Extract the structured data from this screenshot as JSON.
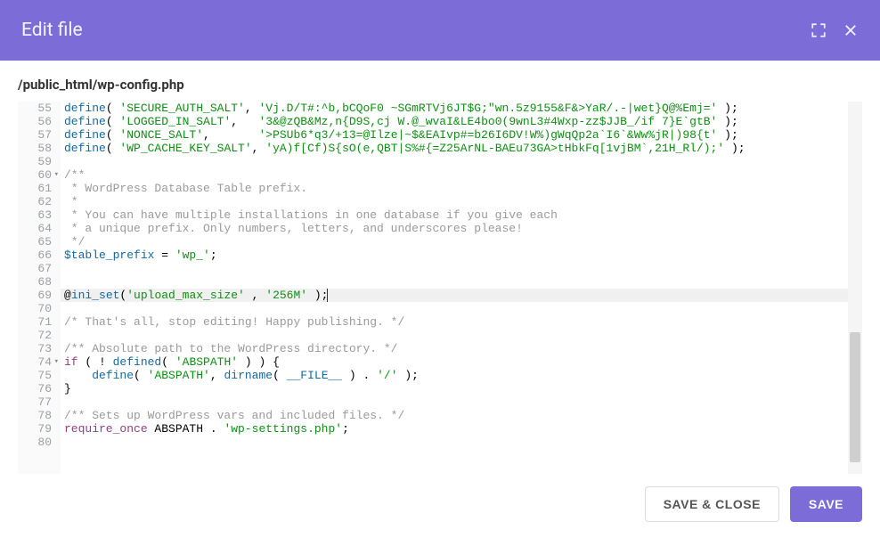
{
  "header": {
    "title": "Edit file"
  },
  "path": "/public_html/wp-config.php",
  "buttons": {
    "save_close": "SAVE & CLOSE",
    "save": "SAVE"
  },
  "editor": {
    "highlighted_line": 69,
    "fold_lines": [
      60,
      74
    ],
    "lines": [
      {
        "n": 55,
        "tokens": [
          [
            "fn",
            "define"
          ],
          [
            "p",
            "( "
          ],
          [
            "str",
            "'SECURE_AUTH_SALT'"
          ],
          [
            "p",
            ", "
          ],
          [
            "str",
            "'Vj.D/T#:^b,bCQoF0 ~SGmRTVj6JT$G;\"wn.5z9155&F&>YaR/.-|wet}Q@%Emj='"
          ],
          [
            "p",
            " );"
          ]
        ]
      },
      {
        "n": 56,
        "tokens": [
          [
            "fn",
            "define"
          ],
          [
            "p",
            "( "
          ],
          [
            "str",
            "'LOGGED_IN_SALT'"
          ],
          [
            "p",
            ",   "
          ],
          [
            "str",
            "'3&@zQB&Mz,n{D9S,cj W.@_wvaI&LE4bo0(9wnL3#4Wxp-zz$JJB_/if 7}E`gtB'"
          ],
          [
            "p",
            " );"
          ]
        ]
      },
      {
        "n": 57,
        "tokens": [
          [
            "fn",
            "define"
          ],
          [
            "p",
            "( "
          ],
          [
            "str",
            "'NONCE_SALT'"
          ],
          [
            "p",
            ",       "
          ],
          [
            "str",
            "'>PSUb6*q3/+13=@Ilze|~$&EAIvp#=b26I6DV!W%)gWqQp2a`I6`&Ww%jR|)98{t'"
          ],
          [
            "p",
            " );"
          ]
        ]
      },
      {
        "n": 58,
        "tokens": [
          [
            "fn",
            "define"
          ],
          [
            "p",
            "( "
          ],
          [
            "str",
            "'WP_CACHE_KEY_SALT'"
          ],
          [
            "p",
            ", "
          ],
          [
            "str",
            "'yA)f[Cf)S{sO(e,QBT|S%#{=Z25ArNL-BAEu73GA>tHbkFq[1vjBM`,21H_Rl/);'"
          ],
          [
            "p",
            " );"
          ]
        ]
      },
      {
        "n": 59,
        "tokens": []
      },
      {
        "n": 60,
        "tokens": [
          [
            "cmt",
            "/**"
          ]
        ]
      },
      {
        "n": 61,
        "tokens": [
          [
            "cmt",
            " * WordPress Database Table prefix."
          ]
        ]
      },
      {
        "n": 62,
        "tokens": [
          [
            "cmt",
            " *"
          ]
        ]
      },
      {
        "n": 63,
        "tokens": [
          [
            "cmt",
            " * You can have multiple installations in one database if you give each"
          ]
        ]
      },
      {
        "n": 64,
        "tokens": [
          [
            "cmt",
            " * a unique prefix. Only numbers, letters, and underscores please!"
          ]
        ]
      },
      {
        "n": 65,
        "tokens": [
          [
            "cmt",
            " */"
          ]
        ]
      },
      {
        "n": 66,
        "tokens": [
          [
            "var",
            "$table_prefix"
          ],
          [
            "p",
            " = "
          ],
          [
            "str",
            "'wp_'"
          ],
          [
            "p",
            ";"
          ]
        ]
      },
      {
        "n": 67,
        "tokens": []
      },
      {
        "n": 68,
        "tokens": []
      },
      {
        "n": 69,
        "tokens": [
          [
            "p",
            "@"
          ],
          [
            "fn",
            "ini_set"
          ],
          [
            "p",
            "("
          ],
          [
            "str",
            "'upload_max_size'"
          ],
          [
            "p",
            " , "
          ],
          [
            "str",
            "'256M'"
          ],
          [
            "p",
            " );"
          ],
          [
            "caret",
            ""
          ]
        ]
      },
      {
        "n": 70,
        "tokens": []
      },
      {
        "n": 71,
        "tokens": [
          [
            "cmt2",
            "/* That's all, stop editing! Happy publishing. */"
          ]
        ]
      },
      {
        "n": 72,
        "tokens": []
      },
      {
        "n": 73,
        "tokens": [
          [
            "cmt2",
            "/** Absolute path to the WordPress directory. */"
          ]
        ]
      },
      {
        "n": 74,
        "tokens": [
          [
            "kw",
            "if"
          ],
          [
            "p",
            " ( ! "
          ],
          [
            "fn",
            "defined"
          ],
          [
            "p",
            "( "
          ],
          [
            "str",
            "'ABSPATH'"
          ],
          [
            "p",
            " ) ) {"
          ]
        ]
      },
      {
        "n": 75,
        "tokens": [
          [
            "p",
            "    "
          ],
          [
            "fn",
            "define"
          ],
          [
            "p",
            "( "
          ],
          [
            "str",
            "'ABSPATH'"
          ],
          [
            "p",
            ", "
          ],
          [
            "fn",
            "dirname"
          ],
          [
            "p",
            "( "
          ],
          [
            "const",
            "__FILE__"
          ],
          [
            "p",
            " ) . "
          ],
          [
            "str",
            "'/'"
          ],
          [
            "p",
            " );"
          ]
        ]
      },
      {
        "n": 76,
        "tokens": [
          [
            "p",
            "}"
          ]
        ]
      },
      {
        "n": 77,
        "tokens": []
      },
      {
        "n": 78,
        "tokens": [
          [
            "cmt2",
            "/** Sets up WordPress vars and included files. */"
          ]
        ]
      },
      {
        "n": 79,
        "tokens": [
          [
            "kw",
            "require_once"
          ],
          [
            "p",
            " ABSPATH . "
          ],
          [
            "str",
            "'wp-settings.php'"
          ],
          [
            "p",
            ";"
          ]
        ]
      },
      {
        "n": 80,
        "tokens": []
      }
    ]
  },
  "scrollbar": {
    "thumb_top_pct": 62,
    "thumb_height_pct": 35
  }
}
